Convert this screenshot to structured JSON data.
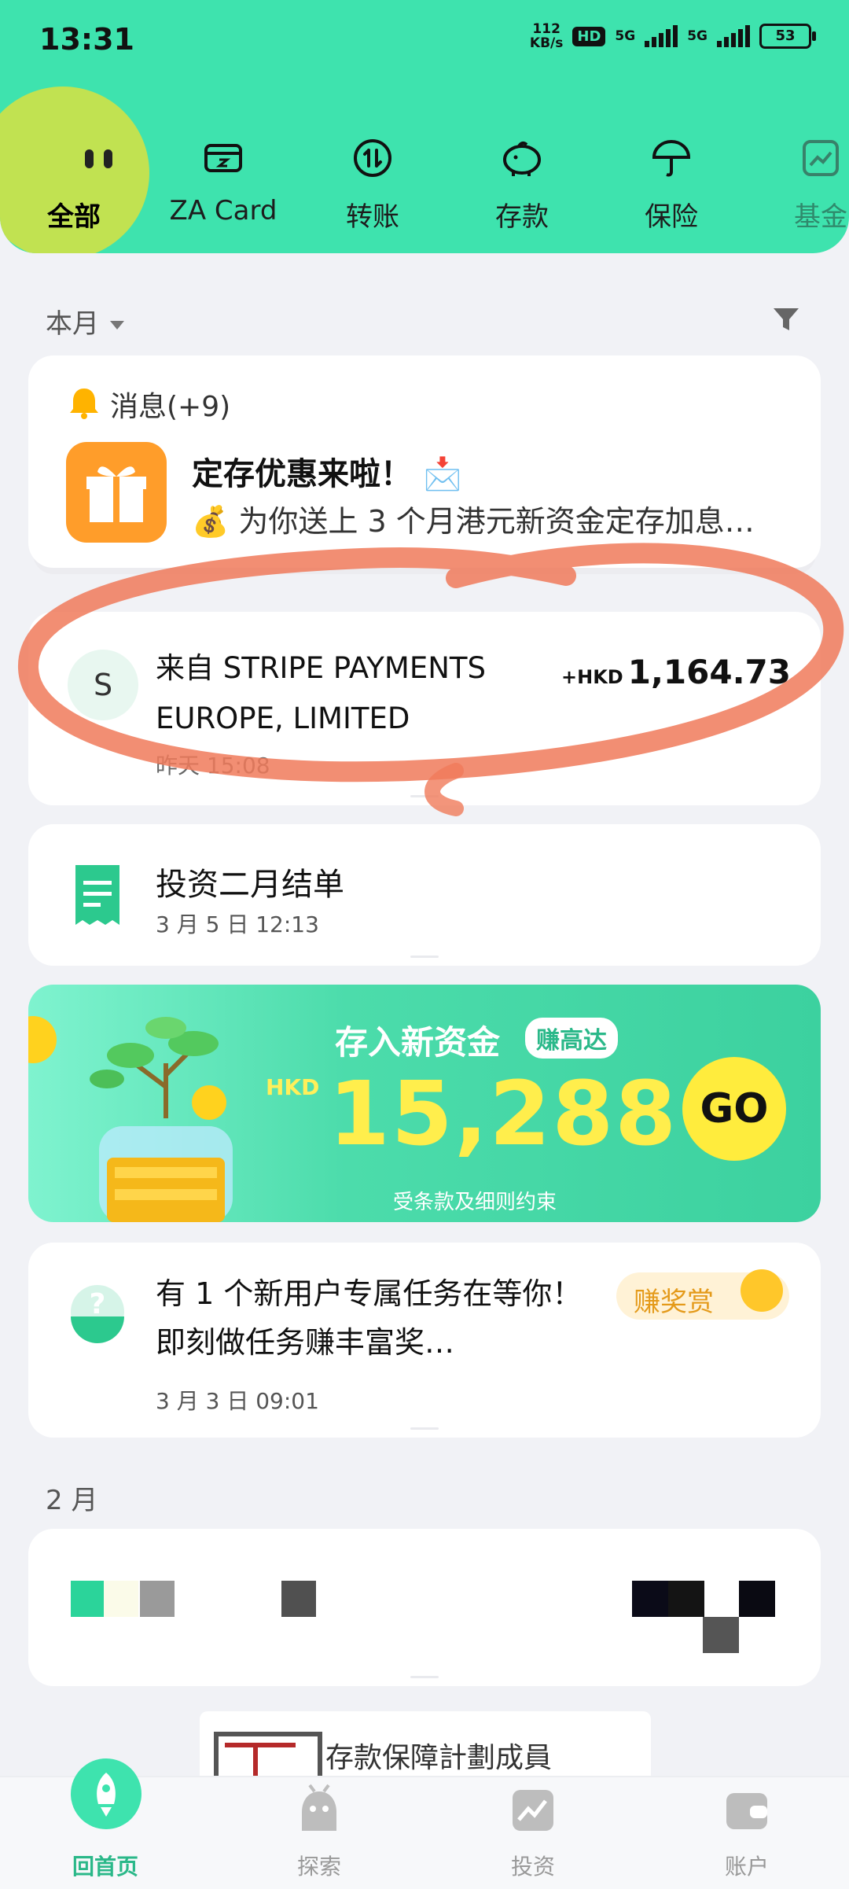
{
  "status_bar": {
    "time": "13:31",
    "speed": "112",
    "speed_unit": "KB/s",
    "hd": "HD",
    "net1": "5G",
    "net2": "5G",
    "battery": "53"
  },
  "categories": [
    {
      "label": "全部",
      "icon": "face-icon"
    },
    {
      "label": "ZA Card",
      "icon": "card-icon"
    },
    {
      "label": "转账",
      "icon": "transfer-icon"
    },
    {
      "label": "存款",
      "icon": "piggy-bank-icon"
    },
    {
      "label": "保险",
      "icon": "umbrella-icon"
    },
    {
      "label": "基金",
      "icon": "fund-chart-icon"
    }
  ],
  "filter": {
    "month": "本月"
  },
  "message": {
    "header": "消息(+9)",
    "title": "定存优惠来啦！",
    "subtitle": "为你送上 3 个月港元新资金定存加息…"
  },
  "transaction": {
    "avatar": "S",
    "title": "来自 STRIPE PAYMENTS EUROPE, LIMITED",
    "date": "昨天 15:08",
    "currency": "+HKD",
    "amount": "1,164.73"
  },
  "statement": {
    "title": "投资二月结单",
    "date": "3 月 5 日 12:13"
  },
  "banner": {
    "title": "存入新资金",
    "tag": "赚高达",
    "currency": "HKD",
    "amount": "15,288",
    "go": "GO",
    "terms": "受条款及细则约束"
  },
  "task": {
    "title": "有 1 个新用户专属任务在等你！即刻做任务赚丰富奖…",
    "date": "3 月 3 日 09:01",
    "badge": "赚奖赏"
  },
  "month_section": "2 月",
  "deposit_notice": "存款保障計劃成員",
  "tabs": [
    {
      "label": "回首页",
      "icon": "rocket-icon"
    },
    {
      "label": "探索",
      "icon": "explore-icon"
    },
    {
      "label": "投资",
      "icon": "invest-icon"
    },
    {
      "label": "账户",
      "icon": "wallet-icon"
    }
  ],
  "colors": {
    "brand": "#3ee3ae",
    "accent": "#2bb889",
    "annotation": "#f07a5a",
    "gold": "#ffee4c"
  }
}
